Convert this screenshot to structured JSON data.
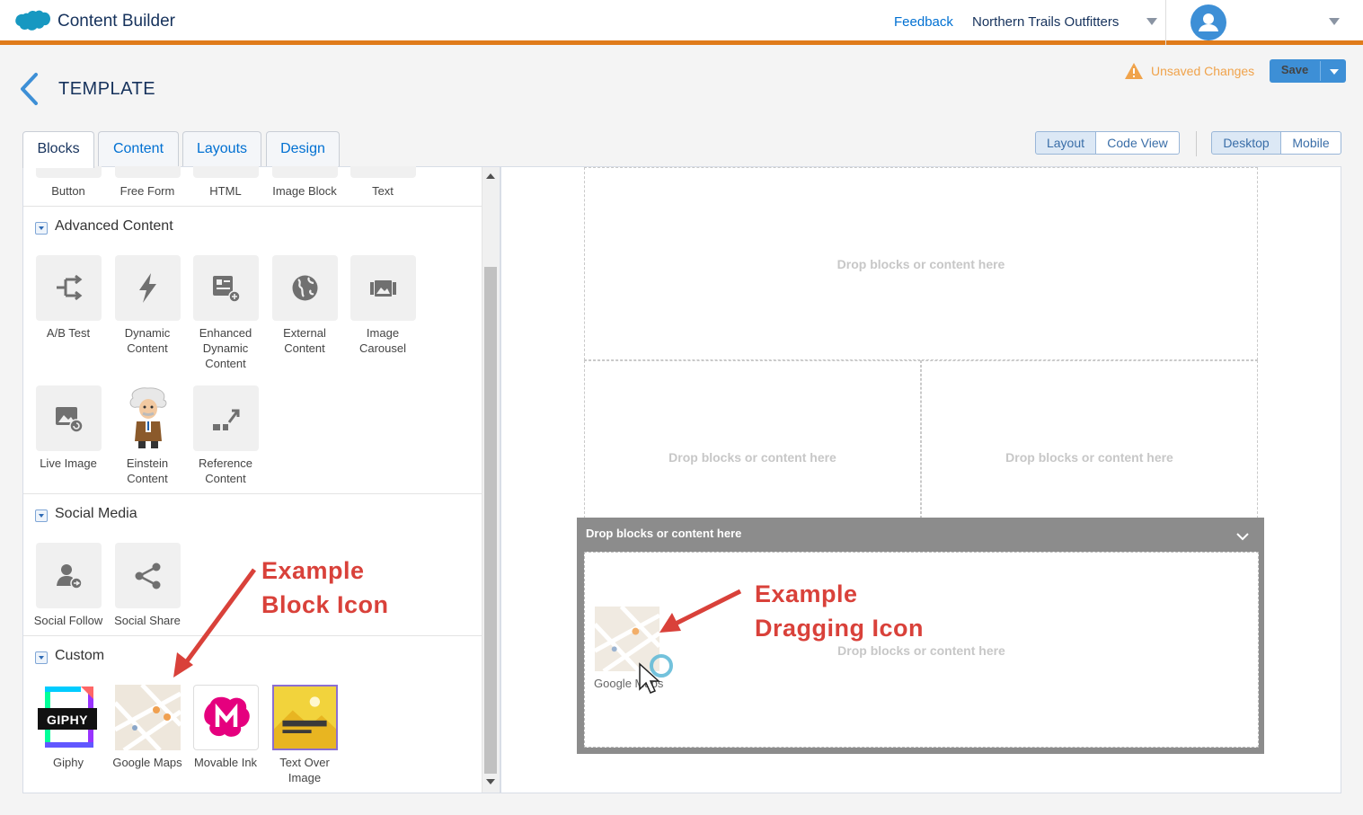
{
  "header": {
    "app_title": "Content Builder",
    "feedback_label": "Feedback",
    "org_name": "Northern Trails Outfitters"
  },
  "toolbar": {
    "page_title": "TEMPLATE",
    "unsaved_label": "Unsaved Changes",
    "save_label": "Save"
  },
  "tabs": [
    {
      "label": "Blocks",
      "active": true
    },
    {
      "label": "Content",
      "active": false
    },
    {
      "label": "Layouts",
      "active": false
    },
    {
      "label": "Design",
      "active": false
    }
  ],
  "view_toggle": {
    "layout": "Layout",
    "code": "Code View"
  },
  "device_toggle": {
    "desktop": "Desktop",
    "mobile": "Mobile"
  },
  "basic_blocks": [
    "Button",
    "Free Form",
    "HTML",
    "Image Block",
    "Text"
  ],
  "sections": {
    "advanced": {
      "title": "Advanced Content",
      "items": [
        {
          "label": "A/B Test",
          "icon": "split-arrows-icon"
        },
        {
          "label": "Dynamic Content",
          "icon": "lightning-icon"
        },
        {
          "label": "Enhanced Dynamic Content",
          "icon": "news-plus-icon"
        },
        {
          "label": "External Content",
          "icon": "globe-icon"
        },
        {
          "label": "Image Carousel",
          "icon": "images-icon"
        },
        {
          "label": "Live Image",
          "icon": "refresh-image-icon"
        },
        {
          "label": "Einstein Content",
          "icon": "einstein-icon"
        },
        {
          "label": "Reference Content",
          "icon": "reference-icon"
        }
      ]
    },
    "social": {
      "title": "Social Media",
      "items": [
        {
          "label": "Social Follow",
          "icon": "follow-icon"
        },
        {
          "label": "Social Share",
          "icon": "share-icon"
        }
      ]
    },
    "custom": {
      "title": "Custom",
      "items": [
        {
          "label": "Giphy",
          "icon": "giphy-logo-icon"
        },
        {
          "label": "Google Maps",
          "icon": "map-thumbnail-icon"
        },
        {
          "label": "Movable Ink",
          "icon": "movable-ink-logo-icon"
        },
        {
          "label": "Text Over Image",
          "icon": "text-over-image-icon"
        }
      ]
    }
  },
  "canvas": {
    "drop_text": "Drop blocks or content here",
    "dragging_label": "Google Maps"
  },
  "annotations": {
    "block_icon": [
      "Example",
      "Block Icon"
    ],
    "dragging_icon": [
      "Example",
      "Dragging Icon"
    ]
  },
  "colors": {
    "accent": "#e07b1a",
    "brand_blue": "#0070d2",
    "save_blue": "#3d8fd6",
    "warning": "#f0a34b",
    "annotation_red": "#d9413a"
  }
}
